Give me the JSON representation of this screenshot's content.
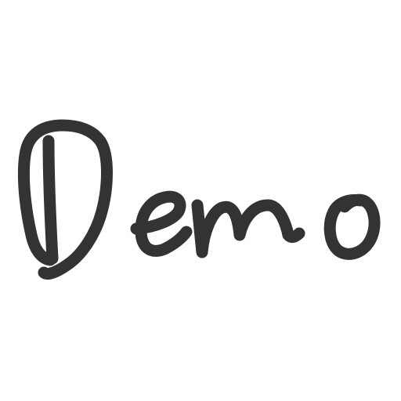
{
  "logo": {
    "text": "Demo",
    "ink_color": "#333333",
    "background_color": "#ffffff"
  }
}
